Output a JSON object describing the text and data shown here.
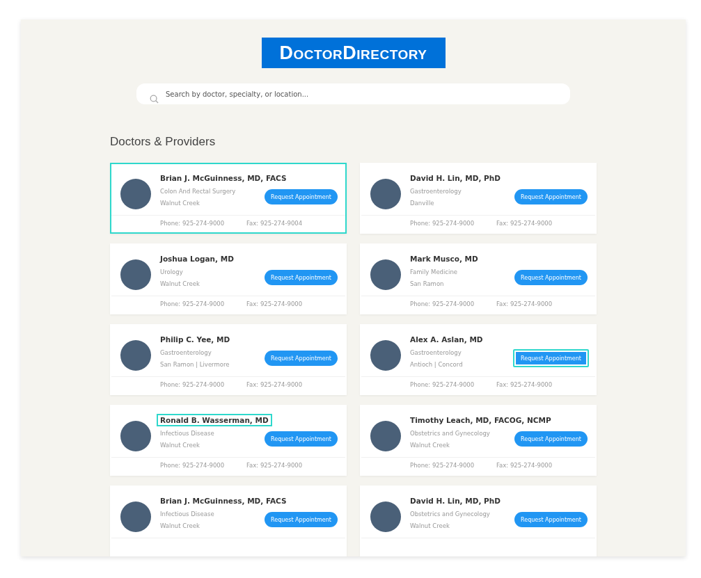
{
  "logo": {
    "text": "DoctorDirectory"
  },
  "search": {
    "placeholder": "Search by doctor, specialty, or location..."
  },
  "heading": "Doctors & Providers",
  "doctors": [
    {
      "name": "Brian J. McGuinness, MD, FACS",
      "specialty": "Colon And Rectal Surgery",
      "location": "Walnut Creek",
      "button": "Request Appointment",
      "phone": "Phone: 925-274-9000",
      "fax": "Fax: 925-274-9004",
      "card_highlighted": true,
      "name_highlighted": false,
      "button_highlighted": false
    },
    {
      "name": "David H. Lin, MD, PhD",
      "specialty": "Gastroenterology",
      "location": "Danville",
      "button": "Request Appointment",
      "phone": "Phone: 925-274-9000",
      "fax": "Fax: 925-274-9000",
      "card_highlighted": false,
      "name_highlighted": false,
      "button_highlighted": false
    },
    {
      "name": "Joshua Logan, MD",
      "specialty": "Urology",
      "location": "Walnut Creek",
      "button": "Request Appointment",
      "phone": "Phone: 925-274-9000",
      "fax": "Fax: 925-274-9000",
      "card_highlighted": false,
      "name_highlighted": false,
      "button_highlighted": false
    },
    {
      "name": "Mark Musco, MD",
      "specialty": "Family Medicine",
      "location": "San Ramon",
      "button": "Request Appointment",
      "phone": "Phone: 925-274-9000",
      "fax": "Fax: 925-274-9000",
      "card_highlighted": false,
      "name_highlighted": false,
      "button_highlighted": false
    },
    {
      "name": "Philip C. Yee, MD",
      "specialty": "Gastroenterology",
      "location": "San Ramon | Livermore",
      "button": "Request Appointment",
      "phone": "Phone: 925-274-9000",
      "fax": "Fax: 925-274-9000",
      "card_highlighted": false,
      "name_highlighted": false,
      "button_highlighted": false
    },
    {
      "name": "Alex A. Aslan, MD",
      "specialty": "Gastroenterology",
      "location": "Antioch | Concord",
      "button": "Request Appointment",
      "phone": "Phone: 925-274-9000",
      "fax": "Fax: 925-274-9000",
      "card_highlighted": false,
      "name_highlighted": false,
      "button_highlighted": true
    },
    {
      "name": "Ronald B. Wasserman, MD",
      "specialty": "Infectious Disease",
      "location": "Walnut Creek",
      "button": "Request Appointment",
      "phone": "Phone: 925-274-9000",
      "fax": "Fax: 925-274-9000",
      "card_highlighted": false,
      "name_highlighted": true,
      "button_highlighted": false
    },
    {
      "name": "Timothy Leach, MD, FACOG, NCMP",
      "specialty": "Obstetrics and Gynecology",
      "location": "Walnut Creek",
      "button": "Request Appointment",
      "phone": "Phone: 925-274-9000",
      "fax": "Fax: 925-274-9000",
      "card_highlighted": false,
      "name_highlighted": false,
      "button_highlighted": false
    },
    {
      "name": "Brian J. McGuinness, MD, FACS",
      "specialty": "Infectious Disease",
      "location": "Walnut Creek",
      "button": "Request Appointment",
      "card_highlighted": false,
      "name_highlighted": false,
      "button_highlighted": false
    },
    {
      "name": "David H. Lin, MD, PhD",
      "specialty": "Obstetrics and Gynecology",
      "location": "Walnut Creek",
      "button": "Request Appointment",
      "card_highlighted": false,
      "name_highlighted": false,
      "button_highlighted": false
    }
  ]
}
